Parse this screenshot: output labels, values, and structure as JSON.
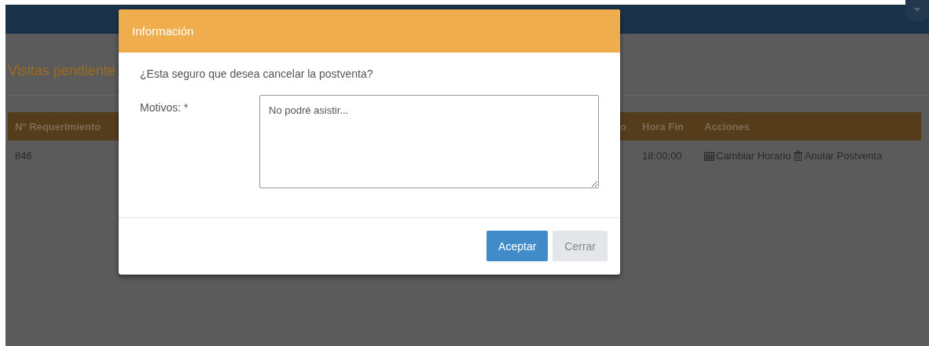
{
  "page": {
    "title": "Visitas pendiente"
  },
  "table": {
    "columns": [
      "N° Requerimiento",
      "o",
      "Hora Fin",
      "Acciones"
    ],
    "rows": [
      {
        "requerimiento": "846",
        "hora_fin": "18:00:00",
        "actions": [
          {
            "kind": "calendar",
            "label": "Cambiar Horario"
          },
          {
            "kind": "trash",
            "label": "Anular Postventa"
          }
        ]
      }
    ]
  },
  "modal": {
    "title": "Información",
    "message": "¿Esta seguro que desea cancelar la postventa?",
    "field": {
      "label": "Motivos: *",
      "value": "No podré asistir..."
    },
    "buttons": [
      {
        "kind": "primary",
        "label": "Aceptar"
      },
      {
        "kind": "default",
        "label": "Cerrar"
      }
    ]
  }
}
